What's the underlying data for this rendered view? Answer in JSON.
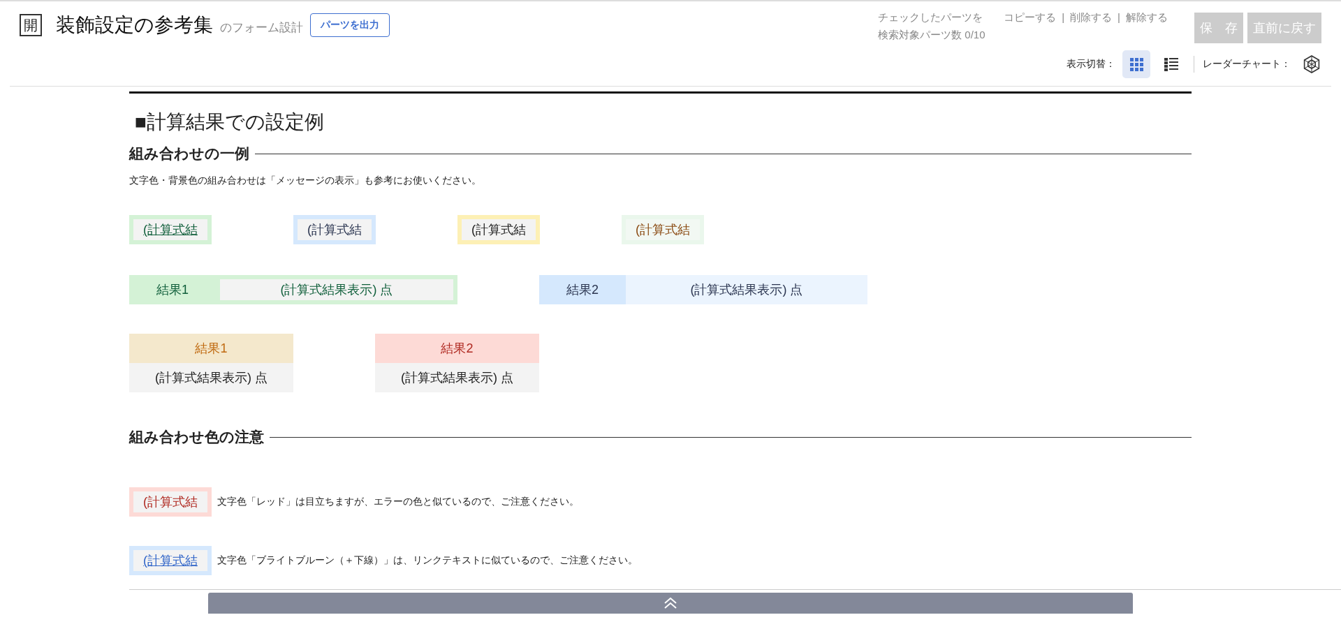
{
  "header": {
    "logo": "開",
    "title": "装飾設定の参考集",
    "subtitle": "のフォーム設計",
    "export_button": "パーツを出力",
    "checked_parts": {
      "label": "チェックしたパーツを",
      "actions": [
        "コピーする",
        "削除する",
        "解除する"
      ],
      "separator": "|"
    },
    "search_count": "検索対象パーツ数 0/10",
    "buttons": [
      {
        "label": "保　存",
        "disabled": true
      },
      {
        "label": "直前に戻す",
        "disabled": true
      }
    ],
    "view_toggle": {
      "label": "表示切替：",
      "options": [
        {
          "kind": "grid",
          "selected": true
        },
        {
          "kind": "list",
          "selected": false
        }
      ]
    },
    "radar_label": "レーダーチャート："
  },
  "section": {
    "title": "■計算結果での設定例",
    "example": {
      "heading": "組み合わせの一例",
      "note": "文字色・背景色の組み合わせは「メッセージの表示」も参考にお使いください。",
      "chips": [
        {
          "kind": "green",
          "text": "(計算式結"
        },
        {
          "kind": "blue",
          "text": "(計算式結"
        },
        {
          "kind": "yellow",
          "text": "(計算式結"
        },
        {
          "kind": "mint",
          "text": "(計算式結"
        }
      ],
      "inline_pairs": [
        {
          "kind": "green",
          "label": "結果1",
          "value": "(計算式結果表示) 点"
        },
        {
          "kind": "blue",
          "label": "結果2",
          "value": "(計算式結果表示) 点"
        }
      ],
      "stacked_pairs": [
        {
          "kind": "tan",
          "label": "結果1",
          "value": "(計算式結果表示) 点"
        },
        {
          "kind": "pink",
          "label": "結果2",
          "value": "(計算式結果表示) 点"
        }
      ]
    },
    "caution": {
      "heading": "組み合わせ色の注意",
      "items": [
        {
          "kind": "red",
          "chip": "(計算式結",
          "text": "文字色「レッド」は目立ちますが、エラーの色と似ているので、ご注意ください。"
        },
        {
          "kind": "link",
          "chip": "(計算式結",
          "text": "文字色「ブライトブルーン（＋下線）」は、リンクテキストに似ているので、ご注意ください。"
        }
      ]
    }
  }
}
